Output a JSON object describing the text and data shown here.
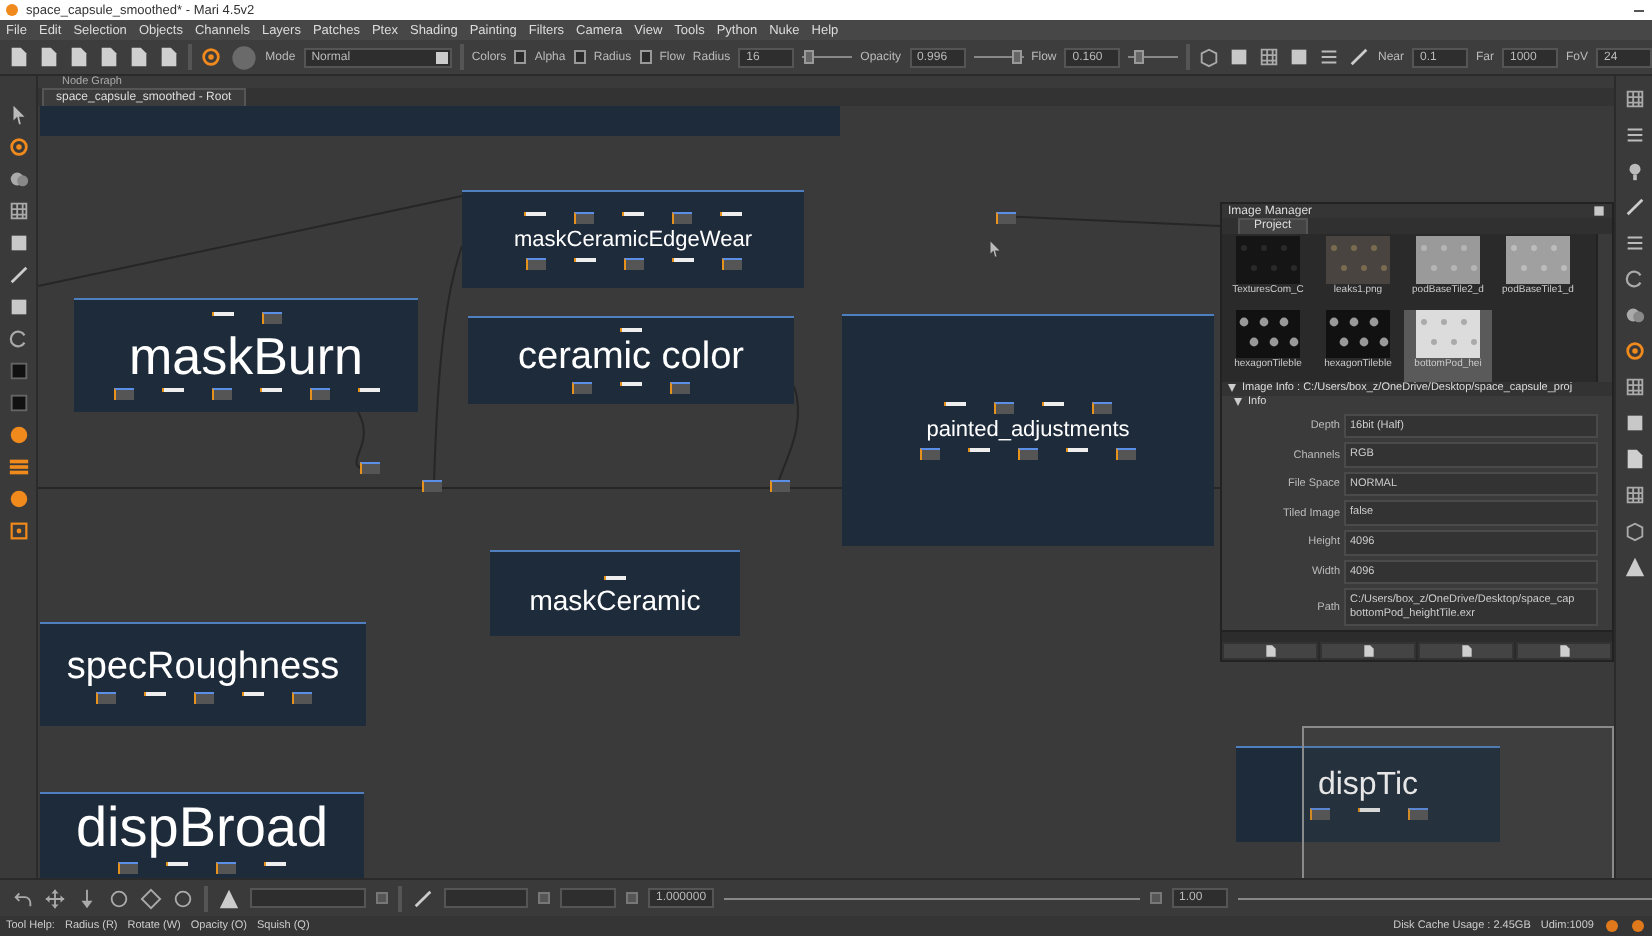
{
  "window": {
    "title": "space_capsule_smoothed* - Mari 4.5v2"
  },
  "menu": [
    "File",
    "Edit",
    "Selection",
    "Objects",
    "Channels",
    "Layers",
    "Patches",
    "Ptex",
    "Shading",
    "Painting",
    "Filters",
    "Camera",
    "View",
    "Tools",
    "Python",
    "Nuke",
    "Help"
  ],
  "toolbar": {
    "mode_label": "Mode",
    "mode_value": "Normal",
    "colors_label": "Colors",
    "checks": [
      {
        "label": "Alpha",
        "checked": false
      },
      {
        "label": "Radius",
        "checked": false
      },
      {
        "label": "Flow",
        "checked": false
      }
    ],
    "sliders": [
      {
        "label": "Radius",
        "value": "16",
        "level": 0.05
      },
      {
        "label": "Opacity",
        "value": "0.996",
        "level": 0.99
      },
      {
        "label": "Flow",
        "value": "0.160",
        "level": 0.16
      }
    ],
    "camera": [
      {
        "label": "Near",
        "value": "0.1"
      },
      {
        "label": "Far",
        "value": "1000"
      },
      {
        "label": "FoV",
        "value": "24"
      }
    ]
  },
  "node_graph": {
    "panel_title": "Node Graph",
    "tab": "space_capsule_smoothed - Root",
    "backdrops": [
      {
        "title": "maskCeramicEdgeWear"
      },
      {
        "title": "maskBurn"
      },
      {
        "title": "ceramic color"
      },
      {
        "title": "painted_adjustments"
      },
      {
        "title": "maskCeramic"
      },
      {
        "title": "specRoughness"
      },
      {
        "title": "dispBroad"
      },
      {
        "title": "dispTic"
      }
    ]
  },
  "image_manager": {
    "title": "Image Manager",
    "tab": "Project",
    "images": [
      {
        "label": "TexturesCom_C",
        "selected": false
      },
      {
        "label": "leaks1.png",
        "selected": false
      },
      {
        "label": "podBaseTile2_d",
        "selected": false
      },
      {
        "label": "podBaseTile1_d",
        "selected": false
      },
      {
        "label": "hexagonTileble",
        "selected": false
      },
      {
        "label": "hexagonTileble",
        "selected": false
      },
      {
        "label": "bottomPod_hei",
        "selected": true
      }
    ],
    "info_title": "Image Info : C:/Users/box_z/OneDrive/Desktop/space_capsule_proj",
    "info_expanded": true,
    "section": "Info",
    "section_expanded": true,
    "fields": [
      {
        "label": "Depth",
        "value": "16bit (Half)"
      },
      {
        "label": "Channels",
        "value": "RGB"
      },
      {
        "label": "File Space",
        "value": "NORMAL"
      },
      {
        "label": "Tiled Image",
        "value": "false"
      },
      {
        "label": "Height",
        "value": "4096"
      },
      {
        "label": "Width",
        "value": "4096"
      },
      {
        "label": "Path",
        "value": "C:/Users/box_z/OneDrive/Desktop/space_cap\nbottomPod_heightTile.exr"
      }
    ]
  },
  "bottom_toolbar": {
    "fields": [
      "1.000000",
      "1.00"
    ]
  },
  "status_bar": {
    "help_label": "Tool Help:",
    "help_items": [
      "Radius (R)",
      "Rotate (W)",
      "Opacity (O)",
      "Squish (Q)"
    ],
    "disk_cache": "Disk Cache Usage : 2.45GB",
    "udim": "Udim:1009"
  }
}
